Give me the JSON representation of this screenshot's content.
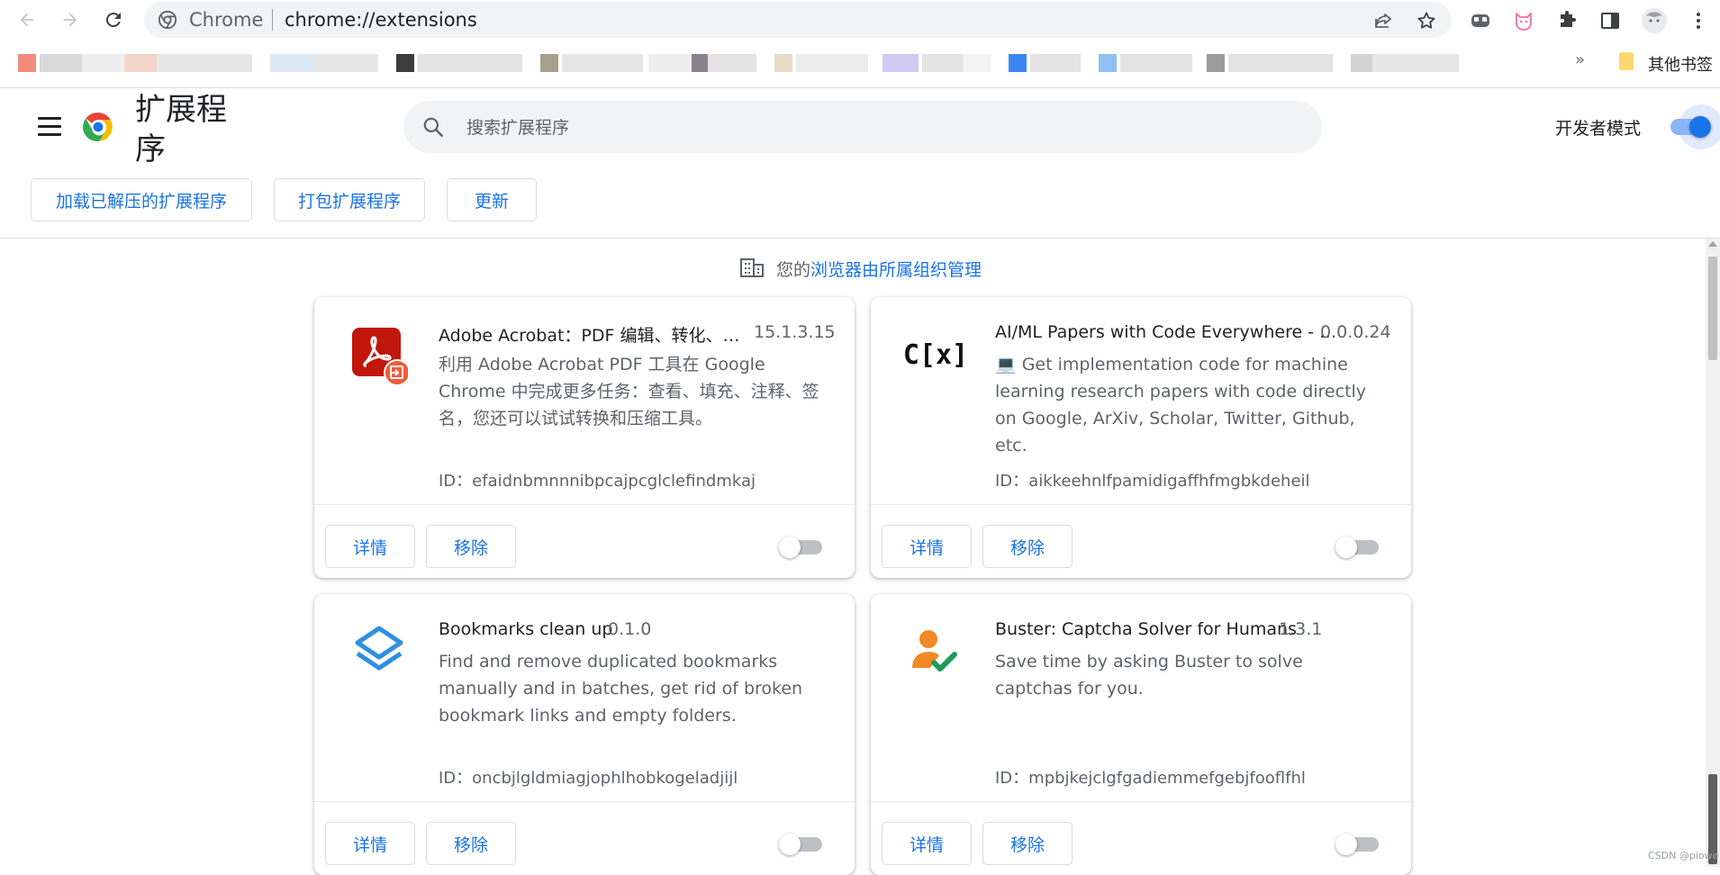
{
  "browser": {
    "omnibox_site": "Chrome",
    "omnibox_url": "chrome://extensions",
    "bookmarks": {
      "more_label": "»",
      "other_bookmarks": "其他书签"
    }
  },
  "header": {
    "title": "扩展程序",
    "search_placeholder": "搜索扩展程序",
    "developer_mode_label": "开发者模式",
    "developer_mode_on": true
  },
  "dev_buttons": {
    "load_unpacked": "加载已解压的扩展程序",
    "pack": "打包扩展程序",
    "update": "更新"
  },
  "managed_notice": {
    "prefix": "您的",
    "link": "浏览器由所属组织管理"
  },
  "extensions": [
    {
      "name": "Adobe Acrobat：PDF 编辑、转化、…",
      "version": "15.1.3.15",
      "description": "利用 Adobe Acrobat PDF 工具在 Google Chrome 中完成更多任务：查看、填充、注释、签名，您还可以试试转换和压缩工具。",
      "id_label": "ID：efaidnbmnnnibpcajpcglclefindmkaj",
      "icon": "adobe-acrobat-icon",
      "details_label": "详情",
      "remove_label": "移除",
      "enabled": false
    },
    {
      "name": "AI/ML Papers with Code Everywhere - …",
      "version": "0.0.0.24",
      "description": "💻 Get implementation code for machine learning research papers with code directly on Google, ArXiv, Scholar, Twitter, Github, etc.",
      "id_label": "ID：aikkeehnlfpamidigaffhfmgbkdeheil",
      "icon": "papers-with-code-icon",
      "icon_text": "C[x]",
      "details_label": "详情",
      "remove_label": "移除",
      "enabled": false
    },
    {
      "name": "Bookmarks clean up",
      "version": "0.1.0",
      "description": "Find and remove duplicated bookmarks manually and in batches, get rid of broken bookmark links and empty folders.",
      "id_label": "ID：oncbjlgldmiagjophlhobkogeladjijl",
      "icon": "layers-icon",
      "details_label": "详情",
      "remove_label": "移除",
      "enabled": false
    },
    {
      "name": "Buster: Captcha Solver for Humans",
      "version": "1.3.1",
      "description": "Save time by asking Buster to solve captchas for you.",
      "id_label": "ID：mpbjkejclgfgadiemmefgebjfooflfhl",
      "icon": "person-check-icon",
      "details_label": "详情",
      "remove_label": "移除",
      "enabled": false
    }
  ],
  "watermark": "CSDN @piowe",
  "colors": {
    "accent": "#1a73e8",
    "text_secondary": "#5f6368",
    "toggle_off": "#bdc1c6"
  }
}
